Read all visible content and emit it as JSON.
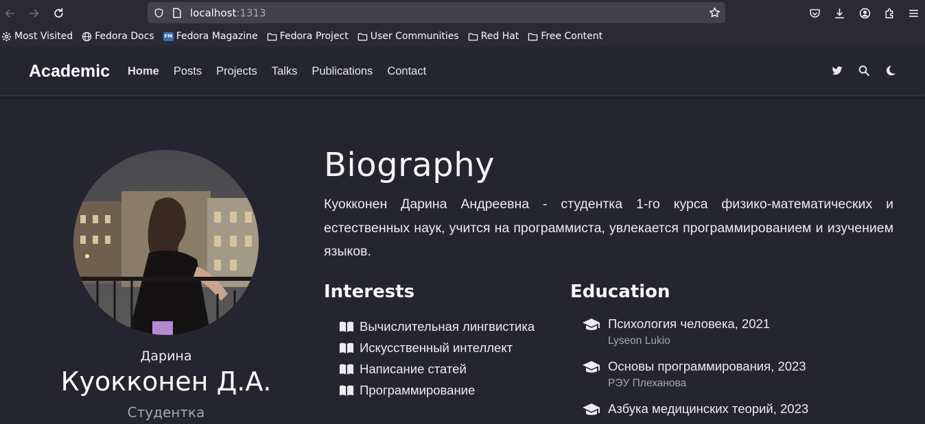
{
  "browser": {
    "url_host": "localhost",
    "url_port": ":1313",
    "bookmarks": [
      {
        "label": "Most Visited",
        "icon": "gear-icon"
      },
      {
        "label": "Fedora Docs",
        "icon": "globe-icon"
      },
      {
        "label": "Fedora Magazine",
        "icon": "fedora-magazine-icon"
      },
      {
        "label": "Fedora Project",
        "icon": "folder-icon"
      },
      {
        "label": "User Communities",
        "icon": "folder-icon"
      },
      {
        "label": "Red Hat",
        "icon": "folder-icon"
      },
      {
        "label": "Free Content",
        "icon": "folder-icon"
      }
    ],
    "fm_badge": "FM"
  },
  "site": {
    "brand": "Academic",
    "nav": [
      "Home",
      "Posts",
      "Projects",
      "Talks",
      "Publications",
      "Contact"
    ],
    "active_nav": "Home"
  },
  "profile": {
    "first_name": "Дарина",
    "name": "Куокконен Д.А.",
    "role": "Студентка"
  },
  "biography": {
    "title": "Biography",
    "text": "Куокконен Дарина Андреевна - студентка 1-го курса физико-математических и естественных наук, учится на программиста, увлекается программированием и изучением языков."
  },
  "interests": {
    "title": "Interests",
    "items": [
      "Вычислительная лингвистика",
      "Искусственный интеллект",
      "Написание статей",
      "Программирование"
    ]
  },
  "education": {
    "title": "Education",
    "items": [
      {
        "course": "Психология человека, 2021",
        "institution": "Lyseon Lukio"
      },
      {
        "course": "Основы программирования, 2023",
        "institution": "РЭУ Плеханова"
      },
      {
        "course": "Азбука медицинских теорий, 2023",
        "institution": ""
      }
    ]
  }
}
